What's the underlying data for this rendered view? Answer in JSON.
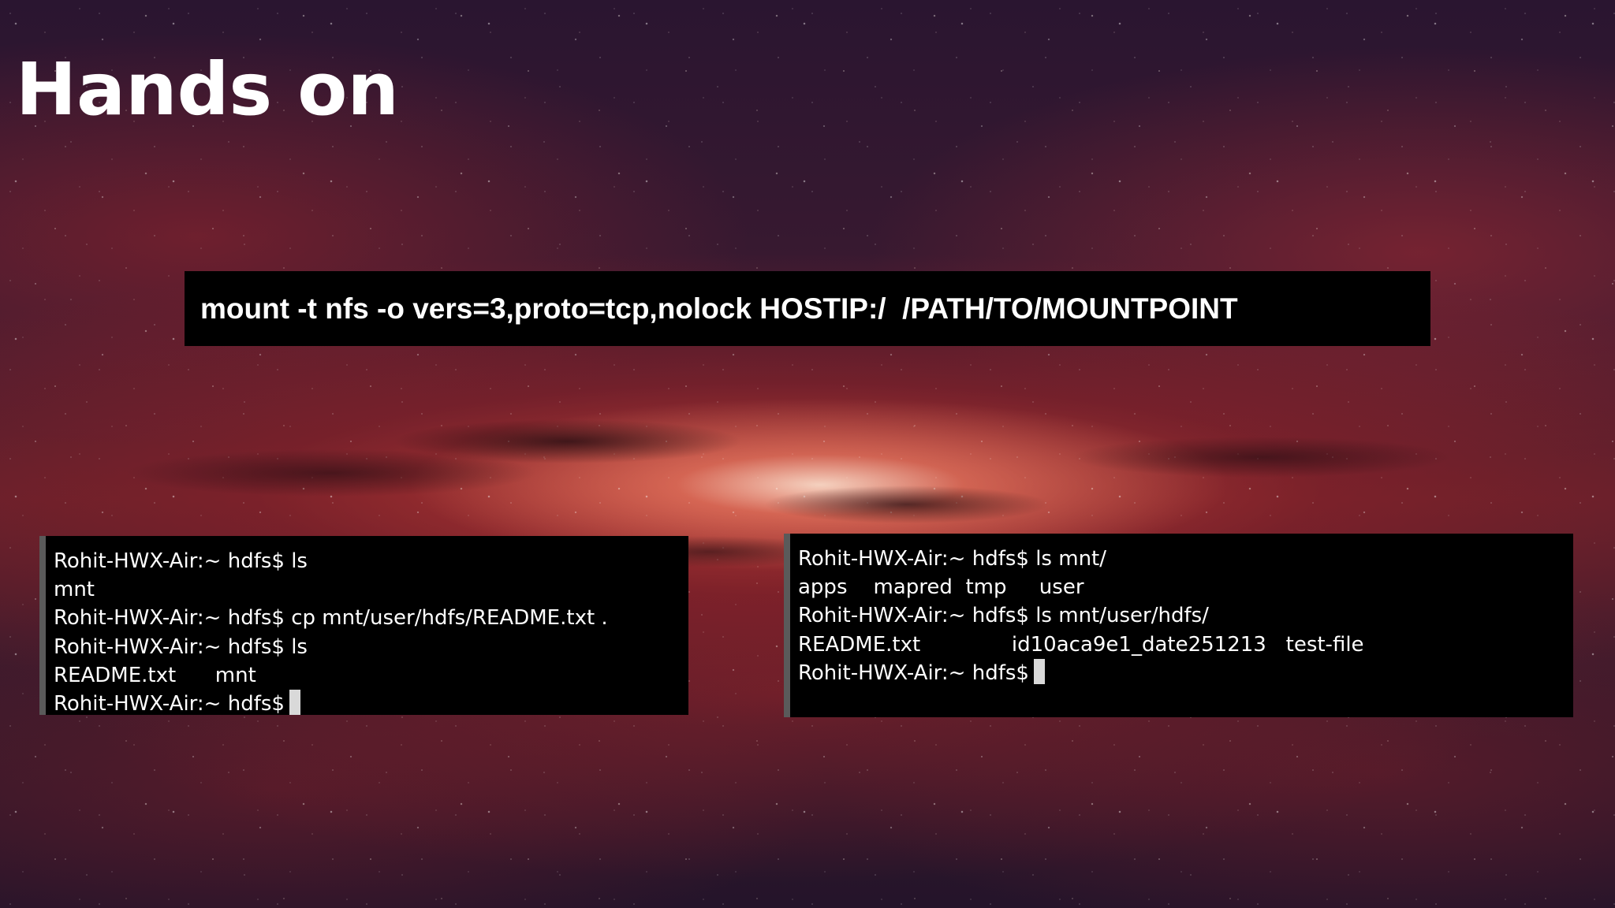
{
  "slide": {
    "title": "Hands on"
  },
  "command_box": {
    "text": "mount -t nfs -o vers=3,proto=tcp,nolock HOSTIP:/  /PATH/TO/MOUNTPOINT"
  },
  "terminal_left": {
    "lines": [
      "Rohit-HWX-Air:~ hdfs$ ls",
      "mnt",
      "Rohit-HWX-Air:~ hdfs$ cp mnt/user/hdfs/README.txt .",
      "Rohit-HWX-Air:~ hdfs$ ls",
      "README.txt      mnt",
      "Rohit-HWX-Air:~ hdfs$"
    ]
  },
  "terminal_right": {
    "lines": [
      "Rohit-HWX-Air:~ hdfs$ ls mnt/",
      "apps    mapred  tmp     user",
      "Rohit-HWX-Air:~ hdfs$ ls mnt/user/hdfs/",
      "README.txt              id10aca9e1_date251213   test-file",
      "Rohit-HWX-Air:~ hdfs$"
    ]
  }
}
